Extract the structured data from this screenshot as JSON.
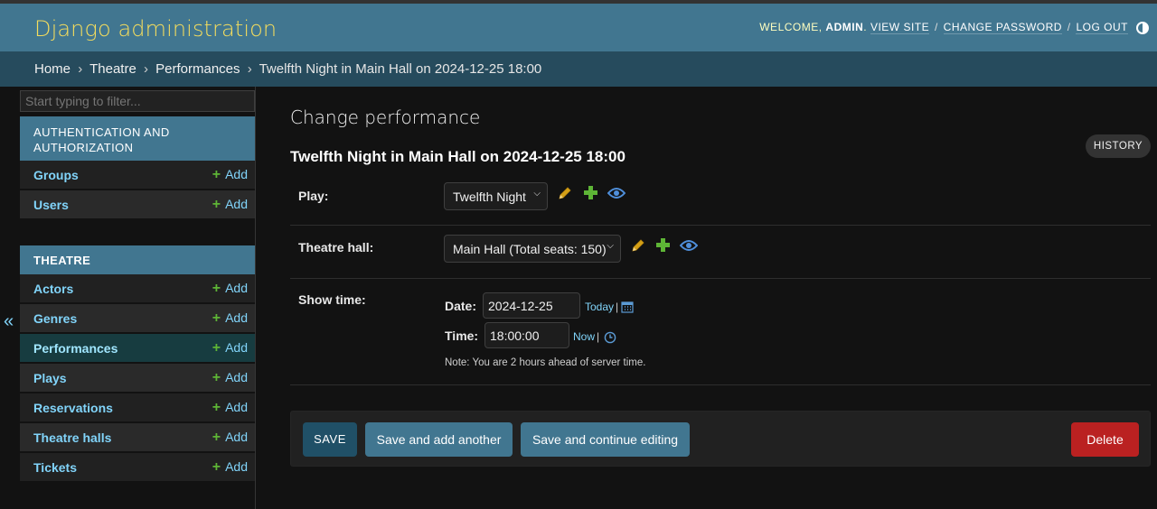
{
  "header": {
    "site_name": "Django administration",
    "welcome": "WELCOME,",
    "username": "ADMIN",
    "view_site": "VIEW SITE",
    "change_password": "CHANGE PASSWORD",
    "log_out": "LOG OUT",
    "sep": "/"
  },
  "breadcrumbs": {
    "home": "Home",
    "app": "Theatre",
    "model": "Performances",
    "current": "Twelfth Night in Main Hall on 2024-12-25 18:00",
    "sep": "›"
  },
  "sidebar": {
    "filter_placeholder": "Start typing to filter...",
    "collapse": "«",
    "add_label": "Add",
    "plus": "+",
    "auth_caption": "AUTHENTICATION AND AUTHORIZATION",
    "auth_items": [
      {
        "label": "Groups"
      },
      {
        "label": "Users"
      }
    ],
    "theatre_caption": "THEATRE",
    "theatre_items": [
      {
        "label": "Actors"
      },
      {
        "label": "Genres"
      },
      {
        "label": "Performances"
      },
      {
        "label": "Plays"
      },
      {
        "label": "Reservations"
      },
      {
        "label": "Theatre halls"
      },
      {
        "label": "Tickets"
      }
    ]
  },
  "main": {
    "page_title": "Change performance",
    "object_title": "Twelfth Night in Main Hall on 2024-12-25 18:00",
    "history": "HISTORY",
    "play_label": "Play:",
    "play_value": "Twelfth Night",
    "hall_label": "Theatre hall:",
    "hall_value": "Main Hall (Total seats: 150)",
    "show_time_label": "Show time:",
    "date_label": "Date:",
    "date_value": "2024-12-25",
    "today": "Today",
    "time_label": "Time:",
    "time_value": "18:00:00",
    "now": "Now",
    "shortcut_sep": "|",
    "note": "Note: You are 2 hours ahead of server time."
  },
  "submit": {
    "save": "SAVE",
    "save_add_another": "Save and add another",
    "save_continue": "Save and continue editing",
    "delete": "Delete"
  },
  "colors": {
    "header_bg": "#417690",
    "breadcrumb_bg": "#264b5d",
    "brand": "#f5dd5d",
    "link": "#81d4fa",
    "add_plus": "#5eb536",
    "delete": "#ba2121",
    "save": "#205067"
  },
  "icons": {
    "change": "pencil-icon",
    "add": "plus-icon",
    "view": "eye-icon",
    "calendar": "calendar-icon",
    "clock": "clock-icon",
    "theme": "theme-toggle-icon"
  }
}
